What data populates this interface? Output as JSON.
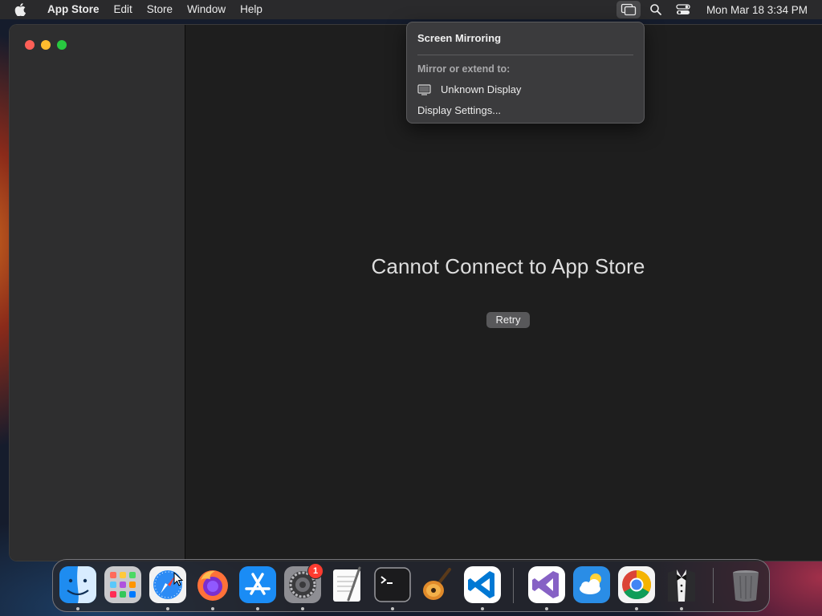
{
  "menubar": {
    "app_name": "App Store",
    "items": [
      "Edit",
      "Store",
      "Window",
      "Help"
    ],
    "status_icons": [
      "screen-mirroring-icon",
      "search-icon",
      "control-center-icon"
    ],
    "clock": "Mon Mar 18  3:34 PM"
  },
  "window": {
    "traffic_lights": [
      "close",
      "minimize",
      "zoom"
    ],
    "error_title": "Cannot Connect to App Store",
    "retry_label": "Retry"
  },
  "screen_mirroring_popover": {
    "title": "Screen Mirroring",
    "section_label": "Mirror or extend to:",
    "display_name": "Unknown Display",
    "settings_label": "Display Settings..."
  },
  "dock": {
    "apps": [
      {
        "name": "Finder",
        "icon": "finder-icon",
        "running": true
      },
      {
        "name": "Launchpad",
        "icon": "launchpad-icon",
        "running": false
      },
      {
        "name": "Safari",
        "icon": "safari-icon",
        "running": true
      },
      {
        "name": "Firefox",
        "icon": "firefox-icon",
        "running": true
      },
      {
        "name": "App Store",
        "icon": "app-store-icon",
        "running": true
      },
      {
        "name": "System Settings",
        "icon": "system-settings-icon",
        "running": true,
        "badge": "1"
      },
      {
        "name": "TextEdit",
        "icon": "textedit-icon",
        "running": false
      },
      {
        "name": "Terminal",
        "icon": "terminal-icon",
        "running": true
      },
      {
        "name": "GarageBand",
        "icon": "garageband-icon",
        "running": false
      },
      {
        "name": "Visual Studio Code",
        "icon": "vscode-icon",
        "running": true
      },
      {
        "name": "Visual Studio",
        "icon": "visual-studio-icon",
        "running": true
      },
      {
        "name": "Weather",
        "icon": "weather-icon",
        "running": false
      },
      {
        "name": "Google Chrome",
        "icon": "chrome-icon",
        "running": true
      },
      {
        "name": "Bartender",
        "icon": "bartender-icon",
        "running": true
      },
      {
        "name": "Trash",
        "icon": "trash-icon",
        "running": false
      }
    ]
  },
  "colors": {
    "menubar_bg": "#2a2a2c",
    "window_bg": "#1e1e1e",
    "sidebar_bg": "#2e2e2f",
    "popover_bg": "#3b3b3d",
    "badge_red": "#ff3b30"
  }
}
